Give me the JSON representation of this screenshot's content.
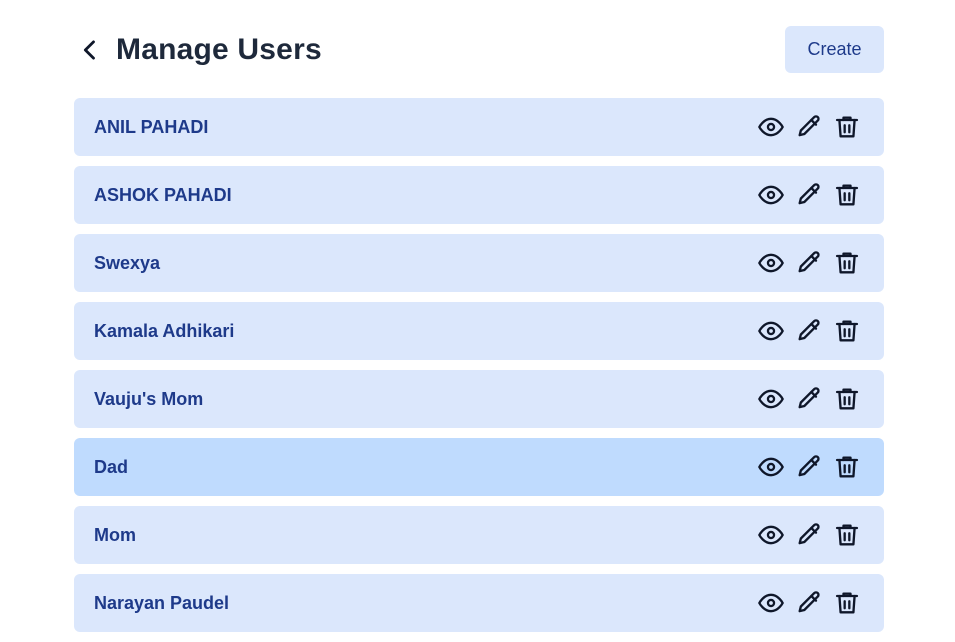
{
  "header": {
    "title": "Manage Users",
    "back_icon": "chevron-left-icon",
    "create_label": "Create"
  },
  "users": [
    {
      "name": "ANIL PAHADI",
      "highlighted": false
    },
    {
      "name": "ASHOK PAHADI",
      "highlighted": false
    },
    {
      "name": "Swexya",
      "highlighted": false
    },
    {
      "name": "Kamala Adhikari",
      "highlighted": false
    },
    {
      "name": "Vauju's Mom",
      "highlighted": false
    },
    {
      "name": "Dad",
      "highlighted": true
    },
    {
      "name": "Mom",
      "highlighted": false
    },
    {
      "name": "Narayan Paudel",
      "highlighted": false
    }
  ],
  "row_actions": [
    "eye-icon",
    "pencil-icon",
    "trash-icon"
  ],
  "colors": {
    "row_bg": "#dbe7fc",
    "row_hover_bg": "#bfdbfe",
    "text_primary": "#1e3a8a",
    "title": "#1e293b"
  }
}
